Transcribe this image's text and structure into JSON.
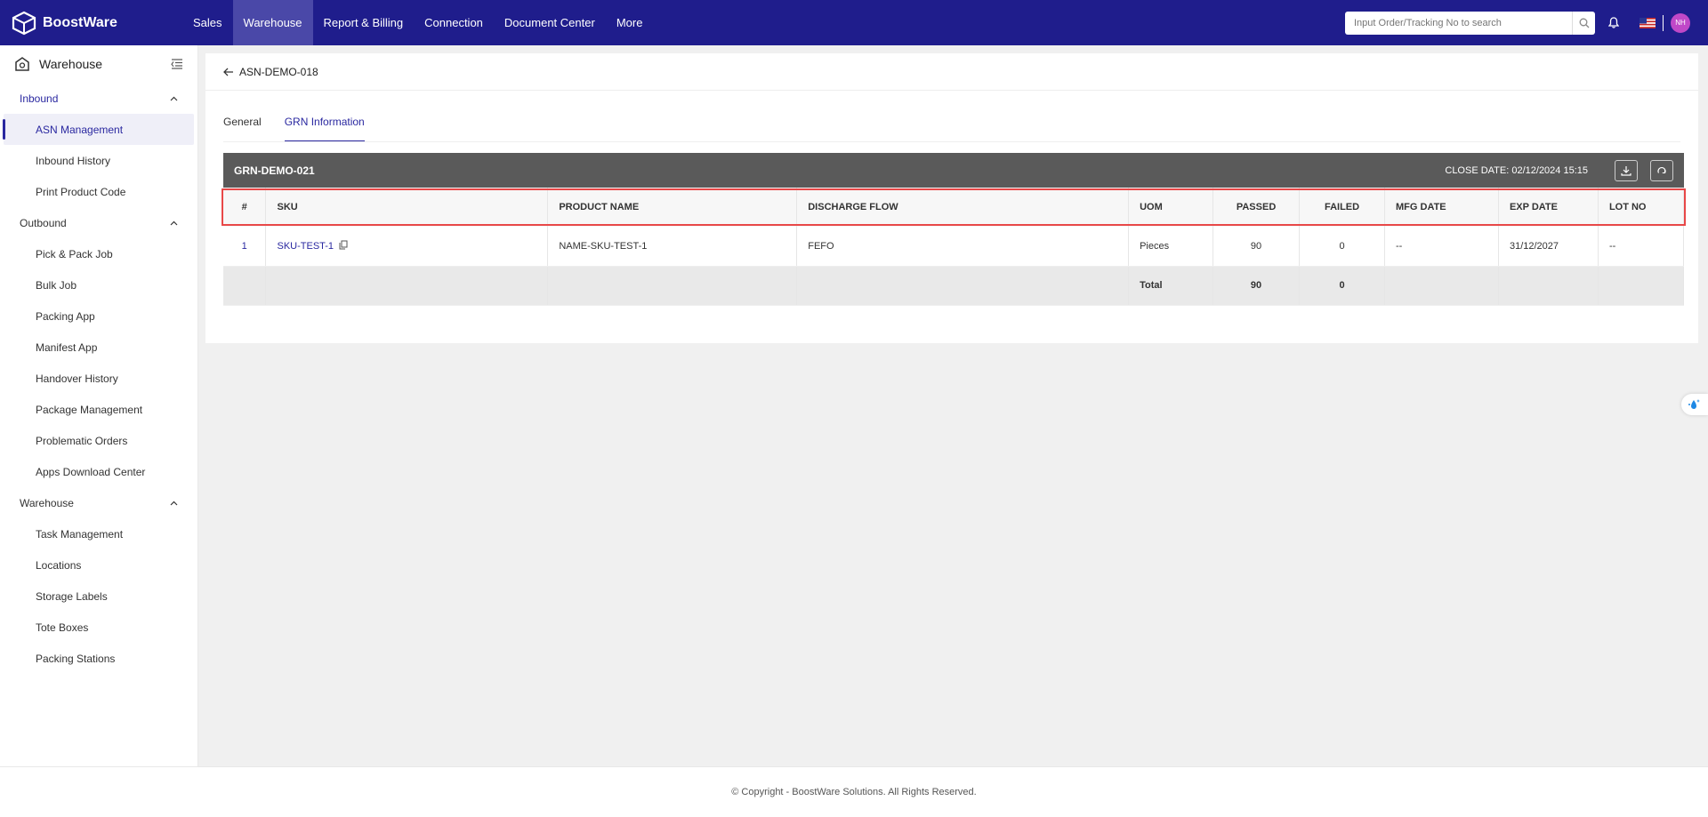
{
  "brand": {
    "name": "BoostWare"
  },
  "nav": [
    "Sales",
    "Warehouse",
    "Report & Billing",
    "Connection",
    "Document Center",
    "More"
  ],
  "search": {
    "placeholder": "Input Order/Tracking No to search"
  },
  "user": {
    "initials": "NH"
  },
  "sidebar": {
    "title": "Warehouse",
    "inbound": {
      "label": "Inbound",
      "items": [
        "ASN Management",
        "Inbound History",
        "Print Product Code"
      ]
    },
    "outbound": {
      "label": "Outbound",
      "items": [
        "Pick & Pack Job",
        "Bulk Job",
        "Packing App",
        "Manifest App",
        "Handover History",
        "Package Management",
        "Problematic Orders",
        "Apps Download Center"
      ]
    },
    "warehouse": {
      "label": "Warehouse",
      "items": [
        "Task Management",
        "Locations",
        "Storage Labels",
        "Tote Boxes",
        "Packing Stations"
      ]
    }
  },
  "page": {
    "title": "ASN-DEMO-018"
  },
  "tabs": [
    "General",
    "GRN Information"
  ],
  "grn": {
    "id": "GRN-DEMO-021",
    "close_date": "CLOSE DATE: 02/12/2024 15:15"
  },
  "table": {
    "headers": [
      "#",
      "SKU",
      "PRODUCT NAME",
      "DISCHARGE FLOW",
      "UOM",
      "PASSED",
      "FAILED",
      "MFG DATE",
      "EXP DATE",
      "LOT NO"
    ],
    "rows": [
      {
        "num": "1",
        "sku": "SKU-TEST-1",
        "product": "NAME-SKU-TEST-1",
        "flow": "FEFO",
        "uom": "Pieces",
        "passed": "90",
        "failed": "0",
        "mfg": "--",
        "exp": "31/12/2027",
        "lot": "--"
      }
    ],
    "total": {
      "label": "Total",
      "passed": "90",
      "failed": "0"
    }
  },
  "footer": {
    "text": "© Copyright - BoostWare Solutions. All Rights Reserved."
  },
  "colors": {
    "primary": "#1f1d8c",
    "accent": "#2a28a0",
    "highlight": "#e84848"
  }
}
